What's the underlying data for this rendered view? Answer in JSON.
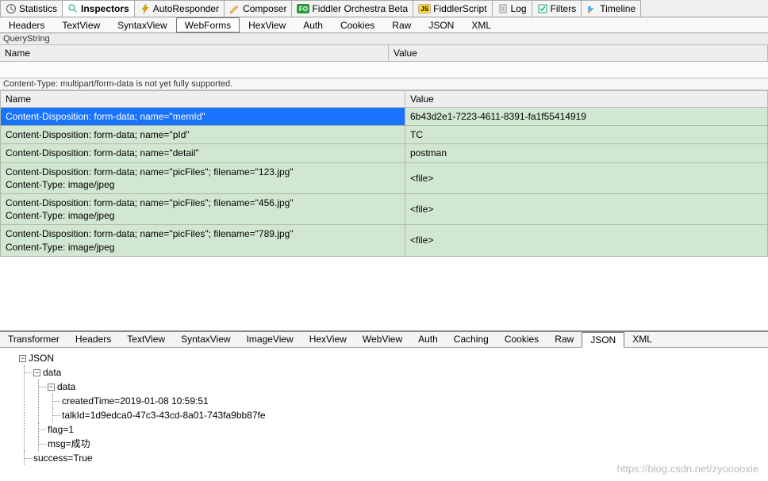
{
  "mainTabs": [
    {
      "label": "Statistics",
      "active": false
    },
    {
      "label": "Inspectors",
      "active": true
    },
    {
      "label": "AutoResponder",
      "active": false
    },
    {
      "label": "Composer",
      "active": false
    },
    {
      "label": "Fiddler Orchestra Beta",
      "active": false
    },
    {
      "label": "FiddlerScript",
      "active": false
    },
    {
      "label": "Log",
      "active": false
    },
    {
      "label": "Filters",
      "active": false
    },
    {
      "label": "Timeline",
      "active": false
    }
  ],
  "reqTabs": [
    "Headers",
    "TextView",
    "SyntaxView",
    "WebForms",
    "HexView",
    "Auth",
    "Cookies",
    "Raw",
    "JSON",
    "XML"
  ],
  "reqTabActive": "WebForms",
  "queryStringLabel": "QueryString",
  "columns": {
    "name": "Name",
    "value": "Value"
  },
  "warning": "Content-Type: multipart/form-data is not yet fully supported.",
  "formColumns": {
    "name": "Name",
    "value": "Value"
  },
  "formRows": [
    {
      "name": "Content-Disposition: form-data; name=\"memId\"",
      "value": "6b43d2e1-7223-4611-8391-fa1f55414919",
      "selected": true
    },
    {
      "name": "Content-Disposition: form-data; name=\"pId\"",
      "value": "TC"
    },
    {
      "name": "Content-Disposition: form-data; name=\"detail\"",
      "value": "postman"
    },
    {
      "name": "Content-Disposition: form-data; name=\"picFiles\"; filename=\"123.jpg\"\nContent-Type: image/jpeg",
      "value": "<file>"
    },
    {
      "name": "Content-Disposition: form-data; name=\"picFiles\"; filename=\"456.jpg\"\nContent-Type: image/jpeg",
      "value": "<file>"
    },
    {
      "name": "Content-Disposition: form-data; name=\"picFiles\"; filename=\"789.jpg\"\nContent-Type: image/jpeg",
      "value": "<file>"
    }
  ],
  "respTabs": [
    "Transformer",
    "Headers",
    "TextView",
    "SyntaxView",
    "ImageView",
    "HexView",
    "WebView",
    "Auth",
    "Caching",
    "Cookies",
    "Raw",
    "JSON",
    "XML"
  ],
  "respTabActive": "JSON",
  "jsonTree": {
    "root": "JSON",
    "data": "data",
    "innerData": "data",
    "createdTime": "createdTime=2019-01-08 10:59:51",
    "talkId": "talkId=1d9edca0-47c3-43cd-8a01-743fa9bb87fe",
    "flag": "flag=1",
    "msg": "msg=成功",
    "success": "success=True"
  },
  "watermark": "https://blog.csdn.net/zyooooxie"
}
